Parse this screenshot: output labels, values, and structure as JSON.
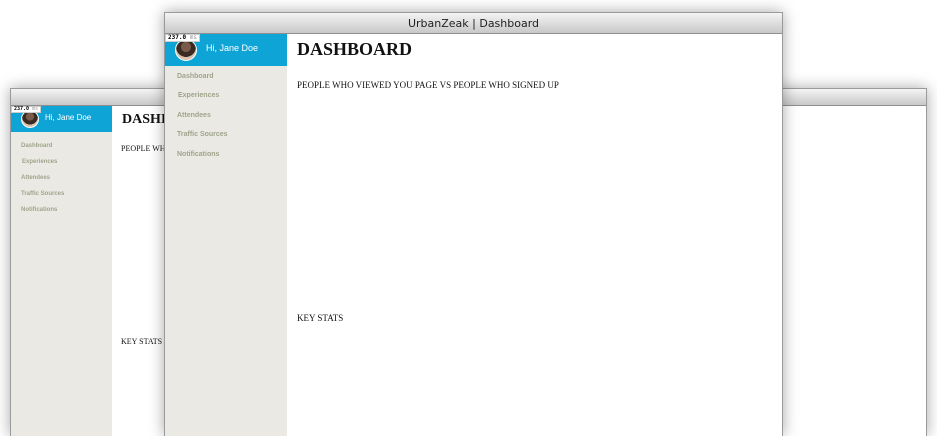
{
  "window": {
    "title": "UrbanZeak | Dashboard"
  },
  "overlay": {
    "value": "237.0",
    "unit": "ms"
  },
  "sidebar": {
    "greeting": "Hi, Jane Doe",
    "items": [
      {
        "label": "Dashboard"
      },
      {
        "label": "Experiences"
      },
      {
        "label": "Attendees"
      },
      {
        "label": "Traffic Sources"
      },
      {
        "label": "Notifications"
      }
    ]
  },
  "main": {
    "heading": "DASHBOARD",
    "chart_caption": "PEOPLE WHO VIEWED YOU PAGE VS PEOPLE WHO SIGNED UP",
    "key_stats": "KEY STATS"
  },
  "back_window": {
    "heading_visible": "DASHI",
    "caption_visible": "PEOPLE WHO"
  }
}
